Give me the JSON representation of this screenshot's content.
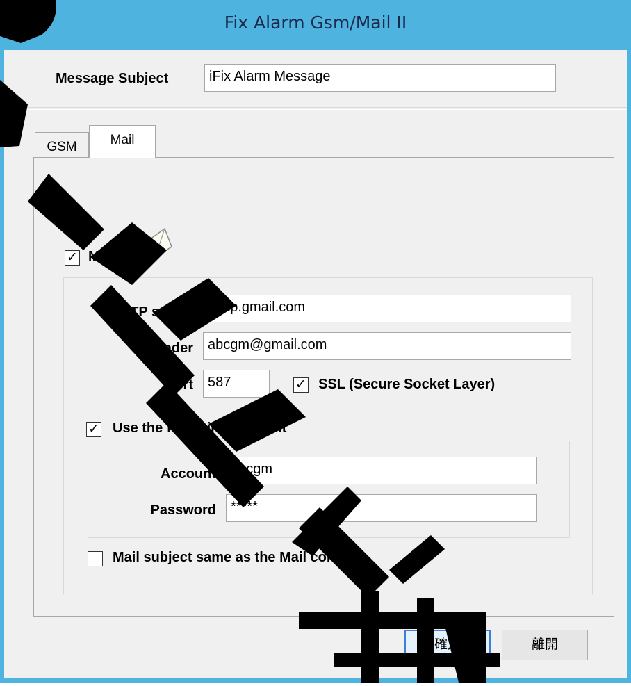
{
  "window": {
    "title": "Fix Alarm Gsm/Mail II",
    "title_bar_color": "#4fb3e0"
  },
  "header": {
    "subject_label": "Message  Subject",
    "subject_value": "iFix Alarm Message"
  },
  "tabs": [
    {
      "label": "GSM",
      "selected": false
    },
    {
      "label": "Mail",
      "selected": true
    }
  ],
  "mail": {
    "enable_label": "Mail",
    "enable_checked": true,
    "enable_icon": "mail-globe-icon",
    "smtp_label": "SMTP server",
    "smtp_value": "smtp.gmail.com",
    "sender_label": "Sender",
    "sender_value": "abcgm@gmail.com",
    "port_label": "Port",
    "port_value": "587",
    "ssl_label": "SSL (Secure Socket Layer)",
    "ssl_checked": true,
    "use_account_label": "Use the following Account",
    "use_account_checked": true,
    "account_label": "Account",
    "account_value": "abcgm",
    "password_label": "Password",
    "password_value": "*****",
    "subject_same_label": "Mail subject same as the Mail content",
    "subject_same_checked": false
  },
  "buttons": {
    "ok_label": "確定",
    "exit_label": "離開"
  },
  "check_mark": "✓"
}
